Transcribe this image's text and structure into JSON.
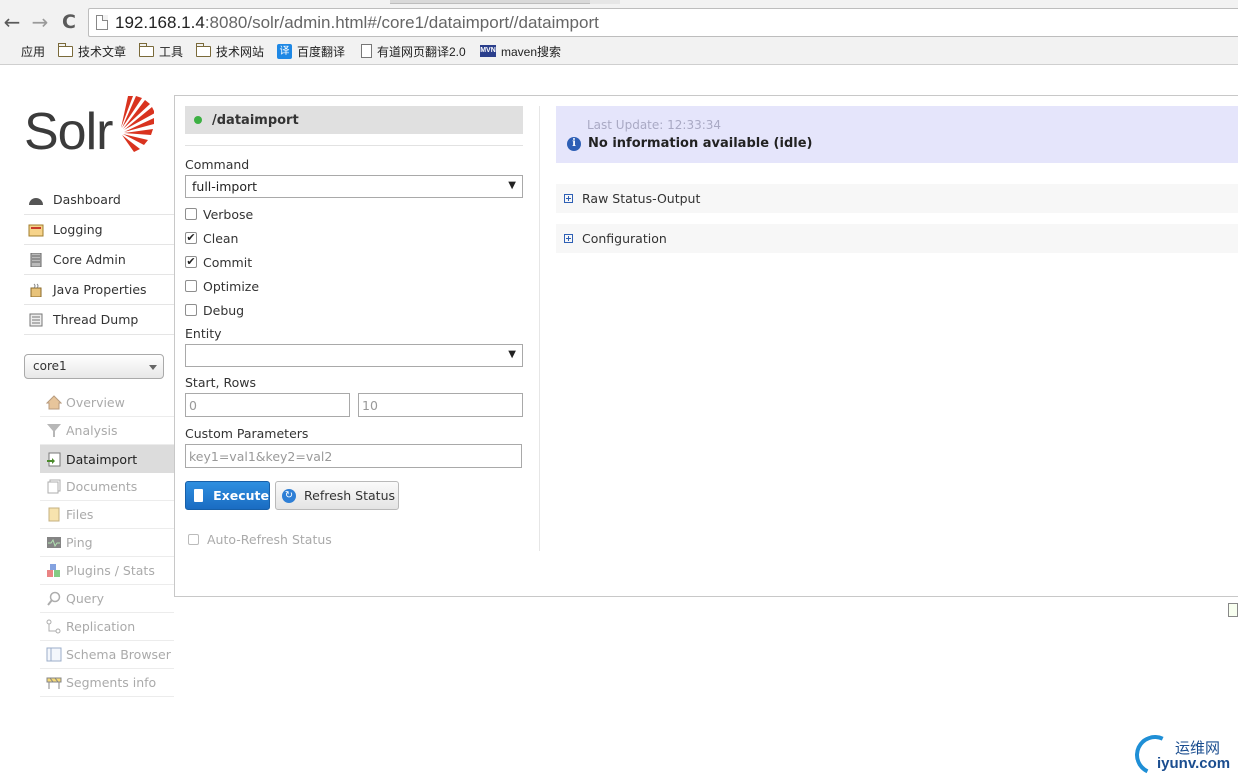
{
  "browser": {
    "url_host": "192.168.1.4",
    "url_rest": ":8080/solr/admin.html#/core1/dataimport//dataimport",
    "bookmarks": [
      {
        "label": "应用",
        "icon": "apps-icon"
      },
      {
        "label": "技术文章",
        "icon": "folder-icon"
      },
      {
        "label": "工具",
        "icon": "folder-icon"
      },
      {
        "label": "技术网站",
        "icon": "folder-icon"
      },
      {
        "label": "百度翻译",
        "icon": "translate-icon"
      },
      {
        "label": "有道网页翻译2.0",
        "icon": "page-icon"
      },
      {
        "label": "maven搜索",
        "icon": "mvn-icon"
      }
    ]
  },
  "logo": {
    "text": "Solr"
  },
  "main_menu": [
    {
      "label": "Dashboard",
      "icon": "dashboard-icon"
    },
    {
      "label": "Logging",
      "icon": "logging-icon"
    },
    {
      "label": "Core Admin",
      "icon": "core-admin-icon"
    },
    {
      "label": "Java Properties",
      "icon": "java-properties-icon"
    },
    {
      "label": "Thread Dump",
      "icon": "thread-dump-icon"
    }
  ],
  "core_selector": {
    "value": "core1"
  },
  "core_menu": [
    {
      "label": "Overview",
      "icon": "overview-icon",
      "active": false
    },
    {
      "label": "Analysis",
      "icon": "analysis-icon",
      "active": false
    },
    {
      "label": "Dataimport",
      "icon": "dataimport-icon",
      "active": true
    },
    {
      "label": "Documents",
      "icon": "documents-icon",
      "active": false
    },
    {
      "label": "Files",
      "icon": "files-icon",
      "active": false
    },
    {
      "label": "Ping",
      "icon": "ping-icon",
      "active": false
    },
    {
      "label": "Plugins / Stats",
      "icon": "plugins-icon",
      "active": false
    },
    {
      "label": "Query",
      "icon": "query-icon",
      "active": false
    },
    {
      "label": "Replication",
      "icon": "replication-icon",
      "active": false
    },
    {
      "label": "Schema Browser",
      "icon": "schema-browser-icon",
      "active": false
    },
    {
      "label": "Segments info",
      "icon": "segments-icon",
      "active": false
    }
  ],
  "dataimport": {
    "handler": "/dataimport",
    "command_label": "Command",
    "command_value": "full-import",
    "options": [
      {
        "label": "Verbose",
        "checked": false
      },
      {
        "label": "Clean",
        "checked": true
      },
      {
        "label": "Commit",
        "checked": true
      },
      {
        "label": "Optimize",
        "checked": false
      },
      {
        "label": "Debug",
        "checked": false
      }
    ],
    "entity_label": "Entity",
    "entity_value": "",
    "start_rows_label": "Start, Rows",
    "start_placeholder": "0",
    "rows_placeholder": "10",
    "custom_params_label": "Custom Parameters",
    "custom_params_placeholder": "key1=val1&key2=val2",
    "execute_label": "Execute",
    "refresh_label": "Refresh Status",
    "auto_refresh_label": "Auto-Refresh Status"
  },
  "status": {
    "last_update": "Last Update: 12:33:34",
    "message": "No information available (idle)"
  },
  "sections": [
    {
      "label": "Raw Status-Output"
    },
    {
      "label": "Configuration"
    }
  ],
  "watermark": {
    "cn": "运维网",
    "en": "iyunv.com"
  },
  "colors": {
    "status_bg": "#e5e5fb",
    "execute_bg": "#1a6cc2",
    "active_dot": "#3cb043",
    "logo_ray": "#d9331f"
  }
}
